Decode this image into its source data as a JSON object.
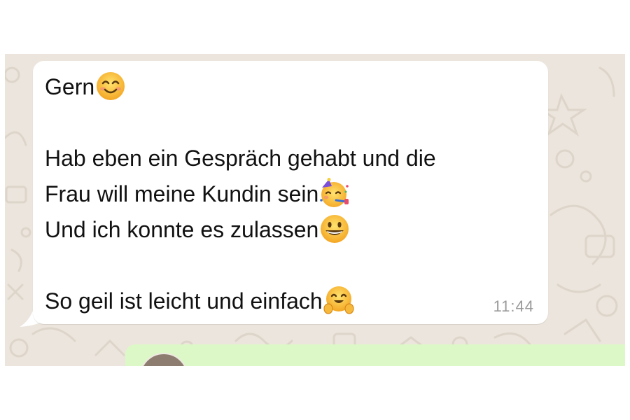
{
  "chat": {
    "incoming_message": {
      "lines": [
        {
          "text": "Gern",
          "emoji": "smiling-face-icon"
        },
        {
          "text": "",
          "emoji": ""
        },
        {
          "text": "Hab eben ein Gespräch gehabt und die",
          "emoji": ""
        },
        {
          "text": "Frau will meine Kundin sein",
          "emoji": "partying-face-icon"
        },
        {
          "text": "Und ich konnte es zulassen",
          "emoji": "grinning-face-icon"
        },
        {
          "text": "",
          "emoji": ""
        },
        {
          "text": "So geil ist leicht und einfach",
          "emoji": "hugging-face-icon"
        }
      ],
      "timestamp": "11:44",
      "bubble_color": "#ffffff"
    },
    "outgoing_message": {
      "bubble_color": "#dcf8c6"
    },
    "wallpaper_color": "#ece5dd"
  }
}
